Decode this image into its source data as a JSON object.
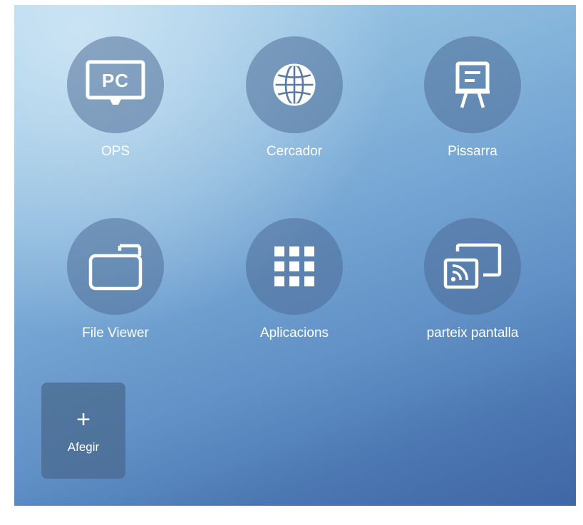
{
  "launcher": {
    "apps": [
      {
        "label": "OPS",
        "icon": "pc-monitor-icon",
        "icon_text": "PC"
      },
      {
        "label": "Cercador",
        "icon": "globe-icon"
      },
      {
        "label": "Pissarra",
        "icon": "whiteboard-icon"
      },
      {
        "label": "File Viewer",
        "icon": "folder-icon"
      },
      {
        "label": "Aplicacions",
        "icon": "app-grid-icon"
      },
      {
        "label": "parteix pantalla",
        "icon": "screen-cast-icon"
      }
    ],
    "add_tile": {
      "icon": "plus",
      "glyph": "+",
      "label": "Afegir"
    }
  },
  "colors": {
    "background_top": "#a9d0ea",
    "background_bottom": "#3f67a5",
    "icon_circle": "#4a6a94",
    "text": "#ffffff"
  }
}
